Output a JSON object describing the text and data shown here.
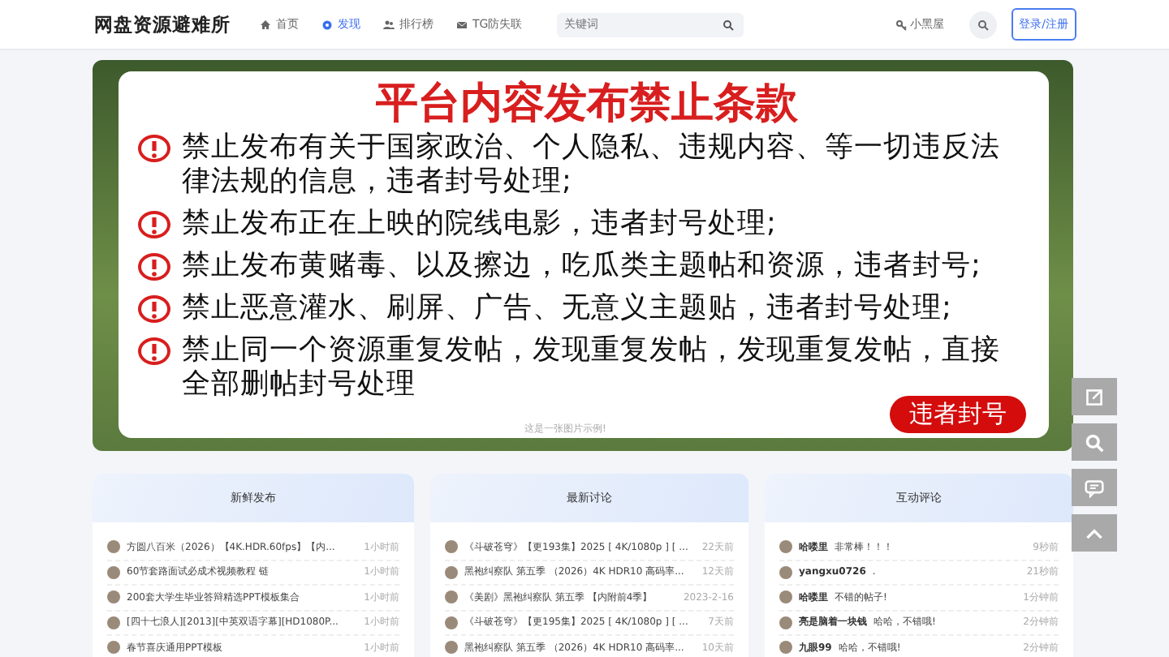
{
  "header": {
    "logo": "网盘资源避难所",
    "nav": [
      {
        "label": "首页",
        "selected": false
      },
      {
        "label": "发现",
        "selected": true
      },
      {
        "label": "排行榜",
        "selected": false
      },
      {
        "label": "TG防失联",
        "selected": false
      }
    ],
    "search": {
      "placeholder": "关键词"
    },
    "user_link": "小黑屋",
    "login_button": "登录/注册"
  },
  "banner": {
    "title": "平台内容发布禁止条款",
    "rules": [
      "禁止发布有关于国家政治、个人隐私、违规内容、等一切违反法律法规的信息，违者封号处理;",
      "禁止发布正在上映的院线电影，违者封号处理;",
      "禁止发布黄赌毒、以及擦边，吃瓜类主题帖和资源，违者封号;",
      "禁止恶意灌水、刷屏、广告、无意义主题贴，违者封号处理;",
      "禁止同一个资源重复发帖，发现重复发帖，发现重复发帖，直接全部删帖封号处理"
    ],
    "caption": "这是一张图片示例!",
    "stamp": "违者封号"
  },
  "panels": [
    {
      "title": "新鲜发布",
      "rows": [
        {
          "text": "方圆八百米（2026）【4K.HDR.60fps】【内...",
          "time": "1小时前"
        },
        {
          "text": "60节套路面试必成术视频教程 链",
          "time": "1小时前"
        },
        {
          "text": "200套大学生毕业答辩精选PPT模板集合",
          "time": "1小时前"
        },
        {
          "text": "[四十七浪人][2013][中英双语字幕][HD1080P...",
          "time": "1小时前"
        },
        {
          "text": "春节喜庆通用PPT模板",
          "time": "1小时前"
        }
      ]
    },
    {
      "title": "最新讨论",
      "rows": [
        {
          "text": "《斗破苍穹》【更193集】2025 [ 4K/1080p ] [ ...",
          "time": "22天前"
        },
        {
          "text": "黑袍纠察队 第五季 （2026）4K HDR10 高码率...",
          "time": "12天前"
        },
        {
          "text": "《美剧》黑袍纠察队 第五季 【内附前4季】",
          "time": "2023-2-16"
        },
        {
          "text": "《斗破苍穹》【更195集】2025 [ 4K/1080p ] [ ...",
          "time": "7天前"
        },
        {
          "text": "黑袍纠察队 第五季 （2026）4K HDR10 高码率...",
          "time": "10天前"
        }
      ]
    },
    {
      "title": "互动评论",
      "rows": [
        {
          "user": "哈喽里",
          "text": "非常棒！！！",
          "time": "9秒前"
        },
        {
          "user": "yangxu0726",
          "text": ".",
          "time": "21秒前"
        },
        {
          "user": "哈喽里",
          "text": "不错的帖子!",
          "time": "1分钟前"
        },
        {
          "user": "亮是脑着一块钱",
          "text": "哈哈，不错哦!",
          "time": "2分钟前"
        },
        {
          "user": "九眼99",
          "text": "哈哈，不错哦!",
          "time": "2分钟前"
        }
      ]
    }
  ]
}
